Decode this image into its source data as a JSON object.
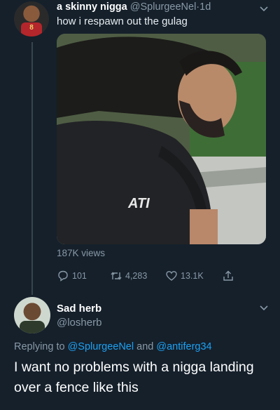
{
  "tweet1": {
    "display_name": "a skinny nigga",
    "handle": "@SplurgeeNel",
    "separator": "·",
    "time": "1d",
    "text": "how i respawn out the gulag",
    "avatar_jersey_number": "8",
    "media_overlay_logo": "ATI",
    "views": "187K views",
    "replies": "101",
    "retweets": "4,283",
    "likes": "13.1K"
  },
  "tweet2": {
    "display_name": "Sad herb",
    "handle": "@losherb",
    "replying_prefix": "Replying to",
    "replying_user1": "@SplurgeeNel",
    "replying_and": "and",
    "replying_user2": "@antiferg34",
    "text": "I want no problems with a nigga landing over a fence like this"
  },
  "colors": {
    "background": "#15202b",
    "muted": "#8899a6",
    "link": "#1da1f2",
    "text": "#ffffff"
  },
  "icons": [
    "chevron-down-icon",
    "reply-icon",
    "retweet-icon",
    "like-icon",
    "share-icon"
  ]
}
